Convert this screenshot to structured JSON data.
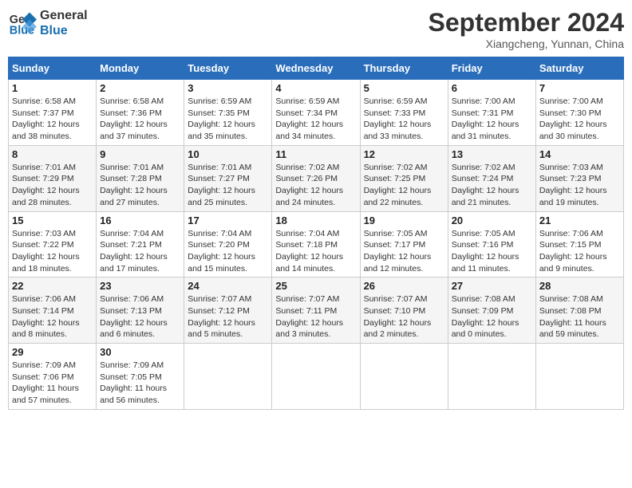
{
  "header": {
    "logo_line1": "General",
    "logo_line2": "Blue",
    "month": "September 2024",
    "location": "Xiangcheng, Yunnan, China"
  },
  "weekdays": [
    "Sunday",
    "Monday",
    "Tuesday",
    "Wednesday",
    "Thursday",
    "Friday",
    "Saturday"
  ],
  "weeks": [
    [
      {
        "day": "1",
        "info": "Sunrise: 6:58 AM\nSunset: 7:37 PM\nDaylight: 12 hours and 38 minutes."
      },
      {
        "day": "2",
        "info": "Sunrise: 6:58 AM\nSunset: 7:36 PM\nDaylight: 12 hours and 37 minutes."
      },
      {
        "day": "3",
        "info": "Sunrise: 6:59 AM\nSunset: 7:35 PM\nDaylight: 12 hours and 35 minutes."
      },
      {
        "day": "4",
        "info": "Sunrise: 6:59 AM\nSunset: 7:34 PM\nDaylight: 12 hours and 34 minutes."
      },
      {
        "day": "5",
        "info": "Sunrise: 6:59 AM\nSunset: 7:33 PM\nDaylight: 12 hours and 33 minutes."
      },
      {
        "day": "6",
        "info": "Sunrise: 7:00 AM\nSunset: 7:31 PM\nDaylight: 12 hours and 31 minutes."
      },
      {
        "day": "7",
        "info": "Sunrise: 7:00 AM\nSunset: 7:30 PM\nDaylight: 12 hours and 30 minutes."
      }
    ],
    [
      {
        "day": "8",
        "info": "Sunrise: 7:01 AM\nSunset: 7:29 PM\nDaylight: 12 hours and 28 minutes."
      },
      {
        "day": "9",
        "info": "Sunrise: 7:01 AM\nSunset: 7:28 PM\nDaylight: 12 hours and 27 minutes."
      },
      {
        "day": "10",
        "info": "Sunrise: 7:01 AM\nSunset: 7:27 PM\nDaylight: 12 hours and 25 minutes."
      },
      {
        "day": "11",
        "info": "Sunrise: 7:02 AM\nSunset: 7:26 PM\nDaylight: 12 hours and 24 minutes."
      },
      {
        "day": "12",
        "info": "Sunrise: 7:02 AM\nSunset: 7:25 PM\nDaylight: 12 hours and 22 minutes."
      },
      {
        "day": "13",
        "info": "Sunrise: 7:02 AM\nSunset: 7:24 PM\nDaylight: 12 hours and 21 minutes."
      },
      {
        "day": "14",
        "info": "Sunrise: 7:03 AM\nSunset: 7:23 PM\nDaylight: 12 hours and 19 minutes."
      }
    ],
    [
      {
        "day": "15",
        "info": "Sunrise: 7:03 AM\nSunset: 7:22 PM\nDaylight: 12 hours and 18 minutes."
      },
      {
        "day": "16",
        "info": "Sunrise: 7:04 AM\nSunset: 7:21 PM\nDaylight: 12 hours and 17 minutes."
      },
      {
        "day": "17",
        "info": "Sunrise: 7:04 AM\nSunset: 7:20 PM\nDaylight: 12 hours and 15 minutes."
      },
      {
        "day": "18",
        "info": "Sunrise: 7:04 AM\nSunset: 7:18 PM\nDaylight: 12 hours and 14 minutes."
      },
      {
        "day": "19",
        "info": "Sunrise: 7:05 AM\nSunset: 7:17 PM\nDaylight: 12 hours and 12 minutes."
      },
      {
        "day": "20",
        "info": "Sunrise: 7:05 AM\nSunset: 7:16 PM\nDaylight: 12 hours and 11 minutes."
      },
      {
        "day": "21",
        "info": "Sunrise: 7:06 AM\nSunset: 7:15 PM\nDaylight: 12 hours and 9 minutes."
      }
    ],
    [
      {
        "day": "22",
        "info": "Sunrise: 7:06 AM\nSunset: 7:14 PM\nDaylight: 12 hours and 8 minutes."
      },
      {
        "day": "23",
        "info": "Sunrise: 7:06 AM\nSunset: 7:13 PM\nDaylight: 12 hours and 6 minutes."
      },
      {
        "day": "24",
        "info": "Sunrise: 7:07 AM\nSunset: 7:12 PM\nDaylight: 12 hours and 5 minutes."
      },
      {
        "day": "25",
        "info": "Sunrise: 7:07 AM\nSunset: 7:11 PM\nDaylight: 12 hours and 3 minutes."
      },
      {
        "day": "26",
        "info": "Sunrise: 7:07 AM\nSunset: 7:10 PM\nDaylight: 12 hours and 2 minutes."
      },
      {
        "day": "27",
        "info": "Sunrise: 7:08 AM\nSunset: 7:09 PM\nDaylight: 12 hours and 0 minutes."
      },
      {
        "day": "28",
        "info": "Sunrise: 7:08 AM\nSunset: 7:08 PM\nDaylight: 11 hours and 59 minutes."
      }
    ],
    [
      {
        "day": "29",
        "info": "Sunrise: 7:09 AM\nSunset: 7:06 PM\nDaylight: 11 hours and 57 minutes."
      },
      {
        "day": "30",
        "info": "Sunrise: 7:09 AM\nSunset: 7:05 PM\nDaylight: 11 hours and 56 minutes."
      },
      {
        "day": "",
        "info": ""
      },
      {
        "day": "",
        "info": ""
      },
      {
        "day": "",
        "info": ""
      },
      {
        "day": "",
        "info": ""
      },
      {
        "day": "",
        "info": ""
      }
    ]
  ]
}
